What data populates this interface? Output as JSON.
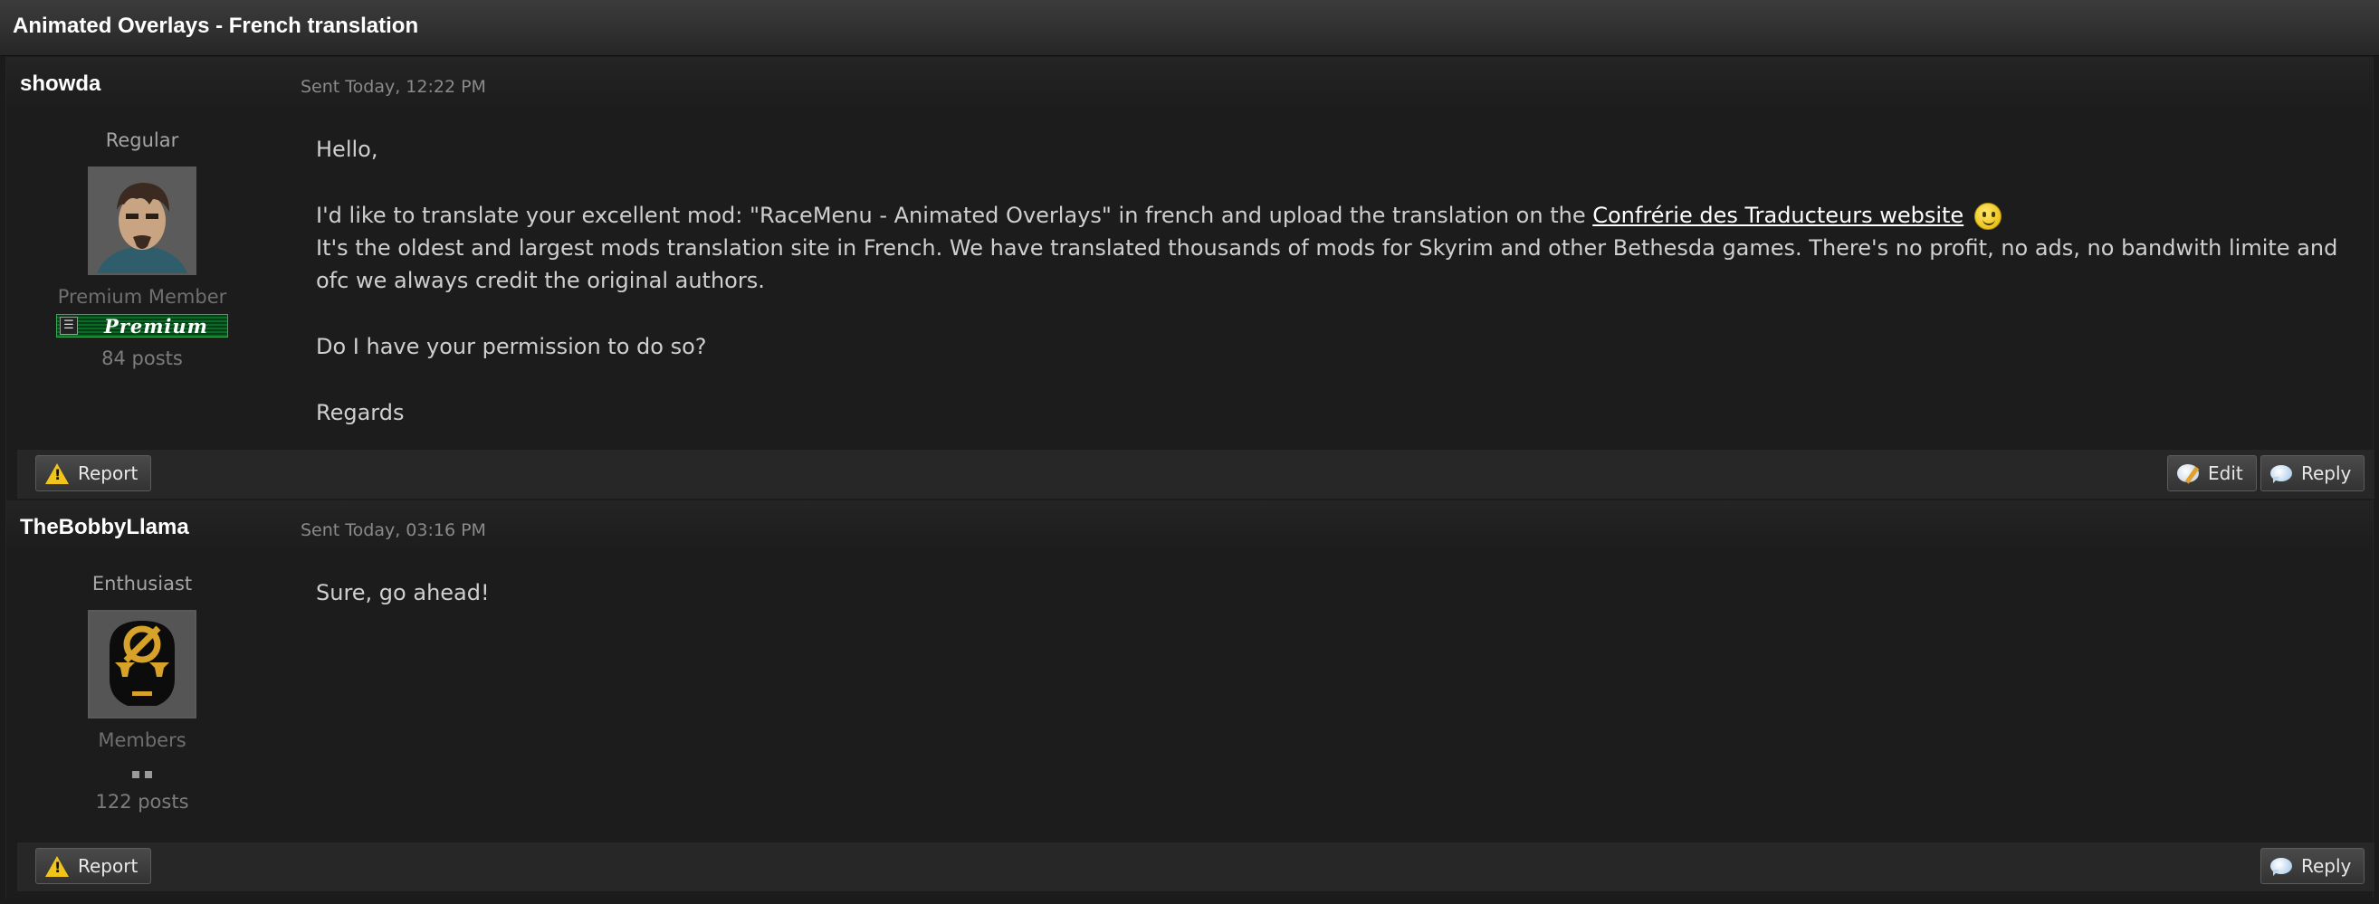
{
  "window": {
    "title": "Animated Overlays - French translation"
  },
  "posts": [
    {
      "author": "showda",
      "date": "Sent Today, 12:22 PM",
      "rank": "Regular",
      "group": "Premium Member",
      "badge": "Premium",
      "post_count": "84 posts",
      "body": {
        "greeting": "Hello,",
        "line1_before_link": "I'd like to translate your excellent mod: \"RaceMenu - Animated Overlays\" in french and upload the translation on the ",
        "link_text": "Confrérie des Traducteurs website",
        "line2": "It's the oldest and largest mods translation site in French. We have translated thousands of mods for Skyrim and other Bethesda games. There's no profit, no ads, no bandwith limite and ofc we always credit the original authors.",
        "question": "Do I have your permission to do so?",
        "signoff": "Regards"
      },
      "buttons": {
        "report": "Report",
        "edit": "Edit",
        "reply": "Reply"
      }
    },
    {
      "author": "TheBobbyLlama",
      "date": "Sent Today, 03:16 PM",
      "rank": "Enthusiast",
      "group": "Members",
      "post_count": "122 posts",
      "body": {
        "text": "Sure, go ahead!"
      },
      "buttons": {
        "report": "Report",
        "reply": "Reply"
      }
    }
  ],
  "colors": {
    "background": "#1b1b1b",
    "accent_gold": "#d7a22a",
    "premium_green": "#0b6b26"
  }
}
